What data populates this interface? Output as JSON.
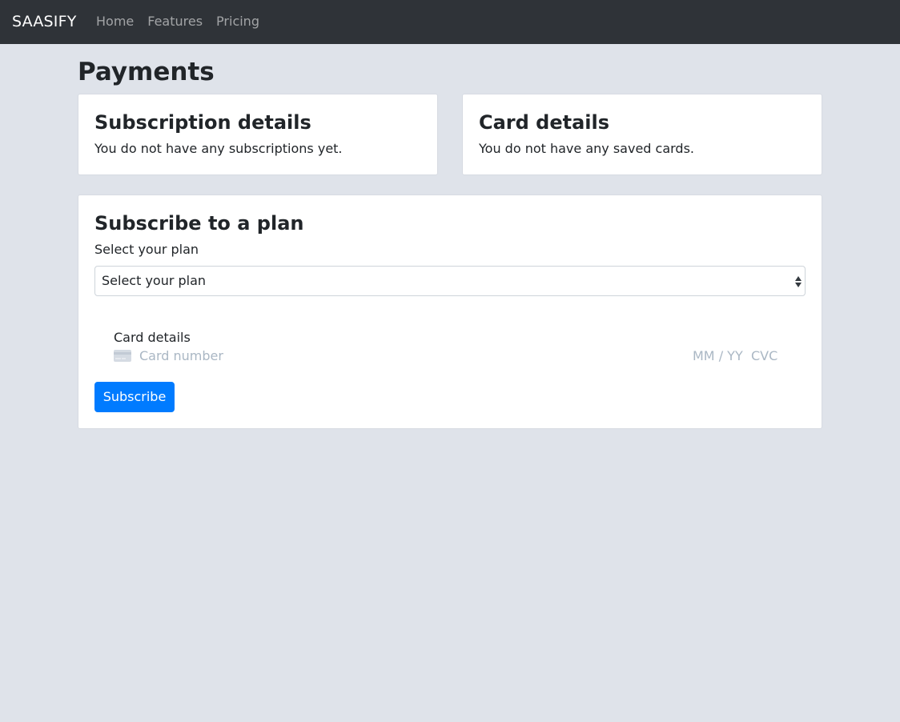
{
  "navbar": {
    "brand": "SAASIFY",
    "links": [
      "Home",
      "Features",
      "Pricing"
    ]
  },
  "page": {
    "title": "Payments"
  },
  "subscription_card": {
    "title": "Subscription details",
    "message": "You do not have any subscriptions yet."
  },
  "saved_cards_card": {
    "title": "Card details",
    "message": "You do not have any saved cards."
  },
  "plan_card": {
    "title": "Subscribe to a plan",
    "select_label": "Select your plan",
    "select_value": "Select your plan",
    "card_details_label": "Card details",
    "card_number_placeholder": "Card number",
    "expiry_placeholder": "MM / YY",
    "cvc_placeholder": "CVC",
    "subscribe_button": "Subscribe"
  },
  "colors": {
    "navbar_bg": "#2f3338",
    "page_bg": "#dfe3ea",
    "primary": "#007bff",
    "placeholder": "#aab7c4"
  },
  "icons": {
    "card_icon": "credit-card-icon",
    "select_arrows": "select-arrows-icon"
  }
}
